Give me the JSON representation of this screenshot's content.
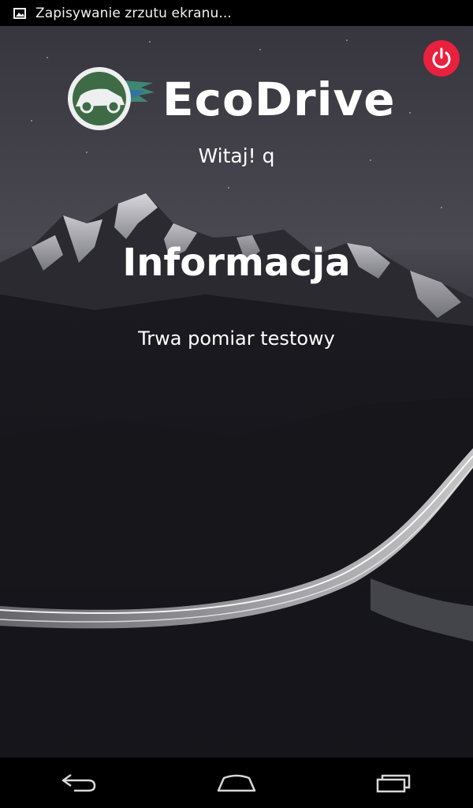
{
  "status_bar": {
    "notification_icon": "image-icon",
    "notification_text": "Zapisywanie zrzutu ekranu..."
  },
  "app": {
    "brand_name": "EcoDrive",
    "greeting": "Witaj! q",
    "dialog_title": "Informacja",
    "dialog_message": "Trwa pomiar testowy",
    "power_button_icon": "power-icon",
    "accent_color": "#e8213f",
    "logo_color": "#3e6b45"
  },
  "nav_bar": {
    "back_icon": "back-icon",
    "home_icon": "home-icon",
    "recents_icon": "recent-apps-icon"
  }
}
